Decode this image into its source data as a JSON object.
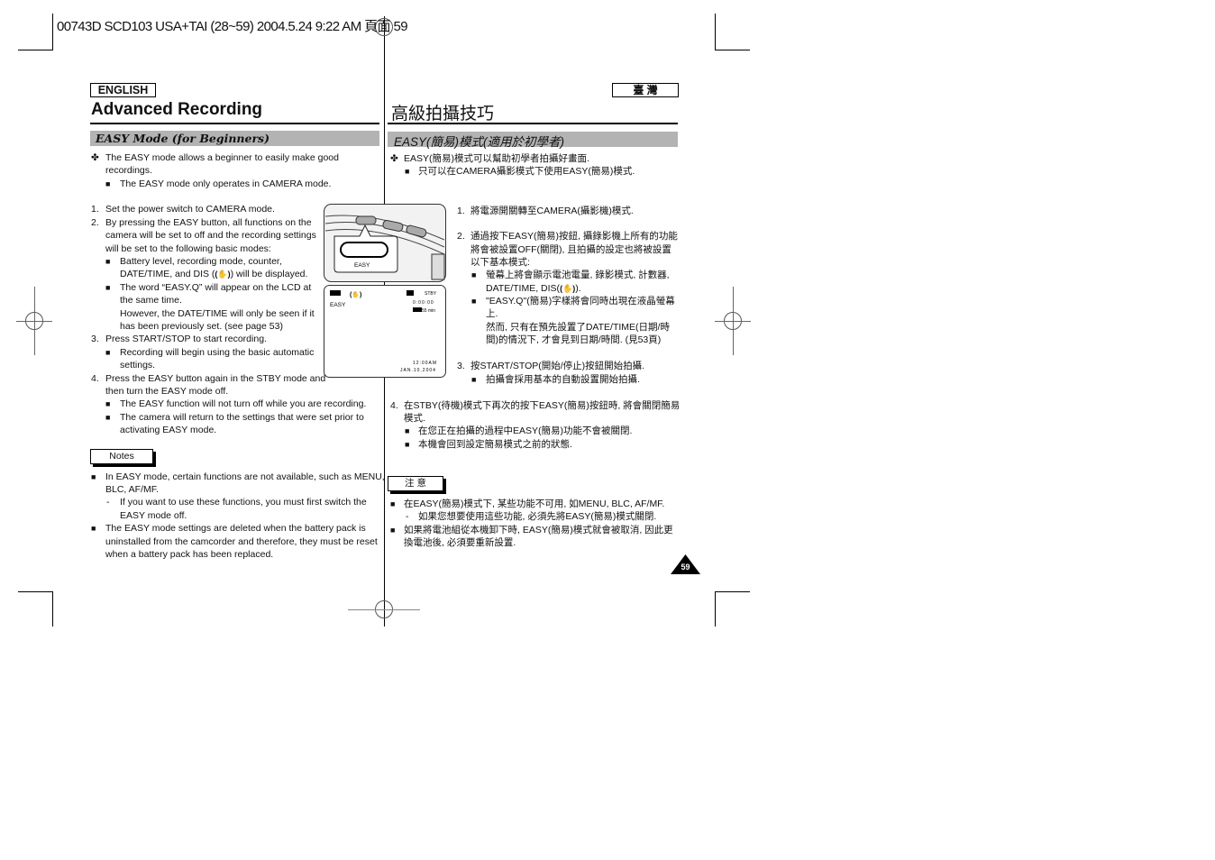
{
  "print_header": "00743D SCD103 USA+TAI (28~59) 2004.5.24  9:22 AM  頁面 59",
  "left": {
    "language_tag": "ENGLISH",
    "title": "Advanced Recording",
    "section": "EASY Mode (for Beginners)",
    "intro": [
      "The EASY mode allows a beginner to easily make good",
      "recordings.",
      "The EASY mode only operates in CAMERA mode."
    ],
    "steps": [
      "1.",
      "Set the power switch to CAMERA mode.",
      "2.",
      "By pressing the EASY button, all functions on the",
      "camera will be set to off and the recording settings",
      "will be set to the following basic modes:",
      "Battery level, recording mode, counter,",
      "DATE/TIME, and DIS (",
      ") will be displayed.",
      "The word “EASY.Q” will appear on the LCD at",
      "the same time.",
      "However, the DATE/TIME will only be seen if it",
      "has been previously set. (see page 53)",
      "3.",
      "Press START/STOP to start recording.",
      "Recording will begin using the basic automatic",
      "settings.",
      "4.",
      "Press the EASY button again in the STBY mode and",
      "then turn the EASY mode off.",
      "The EASY function will not turn off while you are recording.",
      "The camera will return to the settings that were set prior to",
      "activating EASY mode."
    ],
    "notes_label": "Notes",
    "notes": [
      "In EASY mode, certain functions are not available, such as MENU,",
      "BLC, AF/MF.",
      "If you want to use these functions, you must first switch the",
      "EASY mode off.",
      "The EASY mode settings are deleted when the battery pack is",
      "uninstalled from the camcorder and therefore, they must be reset",
      "when a battery pack has been replaced."
    ]
  },
  "right": {
    "language_tag": "臺 灣",
    "title": "高級拍攝技巧",
    "section": "EASY(簡易)模式(適用於初學者)",
    "intro": [
      "EASY(簡易)模式可以幫助初學者拍攝好畫面.",
      "只可以在CAMERA攝影模式下使用EASY(簡易)模式."
    ],
    "steps": [
      "1.",
      "將電源開關轉至CAMERA(攝影機)模式.",
      "2.",
      "通過按下EASY(簡易)按鈕, 攝錄影機上所有的功能",
      "將會被設置OFF(關閉), 且拍攝的設定也將被設置",
      "以下基本模式:",
      "螢幕上將會顯示電池電量, 錄影模式, 計數器,",
      "DATE/TIME, DIS(",
      ").",
      "\"EASY.Q\"(簡易)字樣將會同時出現在液晶螢幕",
      "上.",
      "然而, 只有在預先設置了DATE/TIME(日期/時",
      "間)的情況下, 才會見到日期/時間. (見53頁)",
      "3.",
      "按START/STOP(開始/停止)按鈕開始拍攝.",
      "拍攝會採用基本的自動設置開始拍攝.",
      "4.",
      "在STBY(待機)模式下再次的按下EASY(簡易)按鈕時, 將會關閉簡易",
      "模式.",
      "在您正在拍攝的過程中EASY(簡易)功能不會被關閉.",
      "本機會回到設定簡易模式之前的狀態."
    ],
    "notes_label": "注 意",
    "notes": [
      "在EASY(簡易)模式下, 某些功能不可用, 如MENU, BLC, AF/MF.",
      "如果您想要使用這些功能, 必須先將EASY(簡易)模式關閉.",
      "如果將電池組從本機卸下時, EASY(簡易)模式就會被取消, 因此更",
      "換電池後, 必須要重新設置."
    ]
  },
  "illustration": {
    "button_label": "EASY",
    "lcd": {
      "mode": "EASY",
      "status": "STBY",
      "counter": "0:00:00",
      "remaining": "55 min",
      "time": "12:00AM",
      "date": "JAN.10,2004"
    }
  },
  "page_number": "59",
  "symbols": {
    "diamond": "✤",
    "square": "■",
    "dash": "-",
    "dis": "(✋)"
  }
}
